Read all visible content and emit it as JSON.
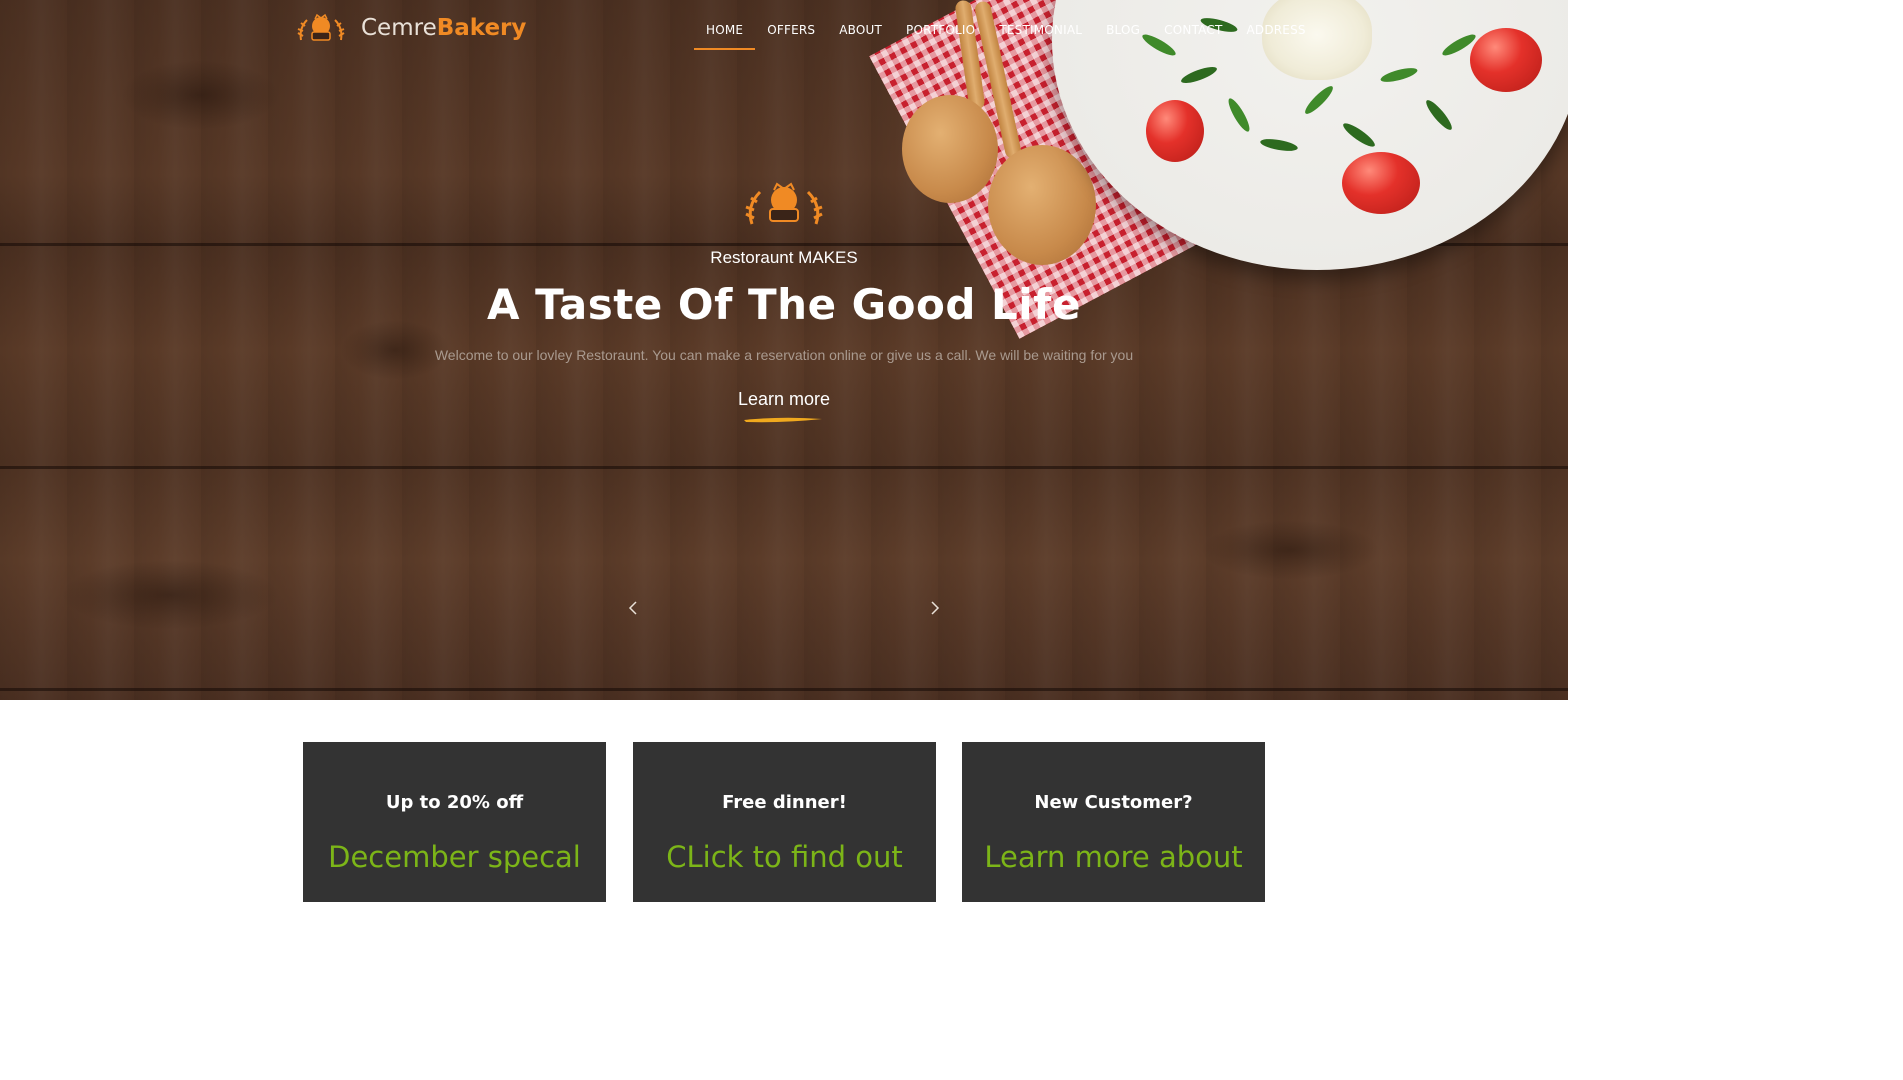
{
  "brand": {
    "name_part1": "Cemre",
    "name_part2": "Bakery",
    "accent_color": "#f08a24"
  },
  "nav": {
    "items": [
      {
        "label": "HOME",
        "active": true
      },
      {
        "label": "OFFERS"
      },
      {
        "label": "ABOUT"
      },
      {
        "label": "PORTFOLIO"
      },
      {
        "label": "TESTIMONIAL"
      },
      {
        "label": "BLOG"
      },
      {
        "label": "CONTACT"
      },
      {
        "label": "ADDRESS"
      }
    ]
  },
  "hero": {
    "subtitle": "Restoraunt MAKES",
    "title": "A Taste Of The Good Life",
    "text": "Welcome to our lovley Restoraunt. You can make a reservation online or give us a call. We will be waiting for you",
    "cta": "Learn more",
    "prev_icon": "chevron-left-icon",
    "next_icon": "chevron-right-icon"
  },
  "offers": {
    "highlight_color": "#7cb518",
    "cards": [
      {
        "title": "Up to 20% off",
        "subtitle": "December specal"
      },
      {
        "title": "Free dinner!",
        "subtitle": "CLick to find out"
      },
      {
        "title": "New Customer?",
        "subtitle": "Learn more about"
      }
    ]
  }
}
